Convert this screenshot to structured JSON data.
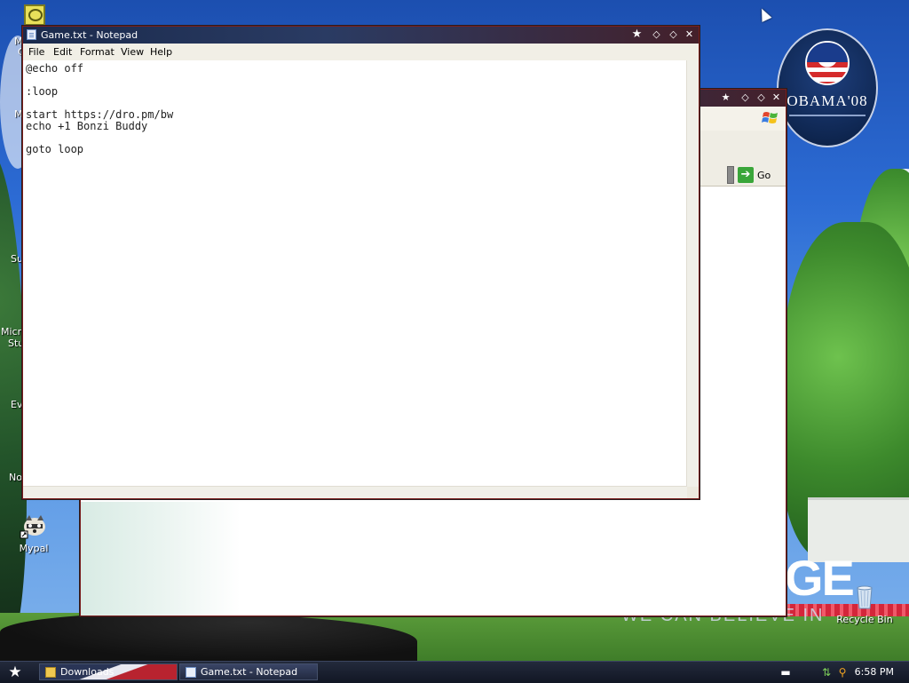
{
  "desktop": {
    "icons": [
      {
        "label": "Mypal"
      },
      {
        "label": "Recycle Bin"
      }
    ],
    "partial_labels": [
      "M",
      "C",
      "M",
      "Su",
      "Micro",
      "Stu",
      "Ev",
      "No"
    ],
    "wallpaper": {
      "badge_text": "OBAMA'08",
      "big_word": "GE",
      "slogan": "WE CAN BELIEVE IN"
    }
  },
  "browser_window": {
    "go_label": "Go"
  },
  "notepad": {
    "title": "Game.txt - Notepad",
    "menu": [
      "File",
      "Edit",
      "Format",
      "View",
      "Help"
    ],
    "content": "@echo off\n\n:loop\n\nstart https://dro.pm/bw\necho +1 Bonzi Buddy\n\ngoto loop"
  },
  "taskbar": {
    "buttons": [
      {
        "label": "Downloads"
      },
      {
        "label": "Game.txt - Notepad"
      }
    ],
    "clock": "6:58 PM"
  },
  "colors": {
    "titlebar_left": "#1a2a4c",
    "titlebar_right": "#44202a",
    "window_border": "#7a1e1e",
    "taskbar": "#111624",
    "go_green": "#3aa63a"
  },
  "icons": [
    "start-star-icon",
    "notepad-file-icon",
    "folder-icon",
    "raccoon-icon",
    "recycle-bin-icon",
    "go-arrow-icon",
    "windows-flag-icon",
    "keyboard-icon",
    "network-icon",
    "search-icon",
    "close-icon",
    "maximize-icon",
    "minimize-icon",
    "pin-icon"
  ]
}
